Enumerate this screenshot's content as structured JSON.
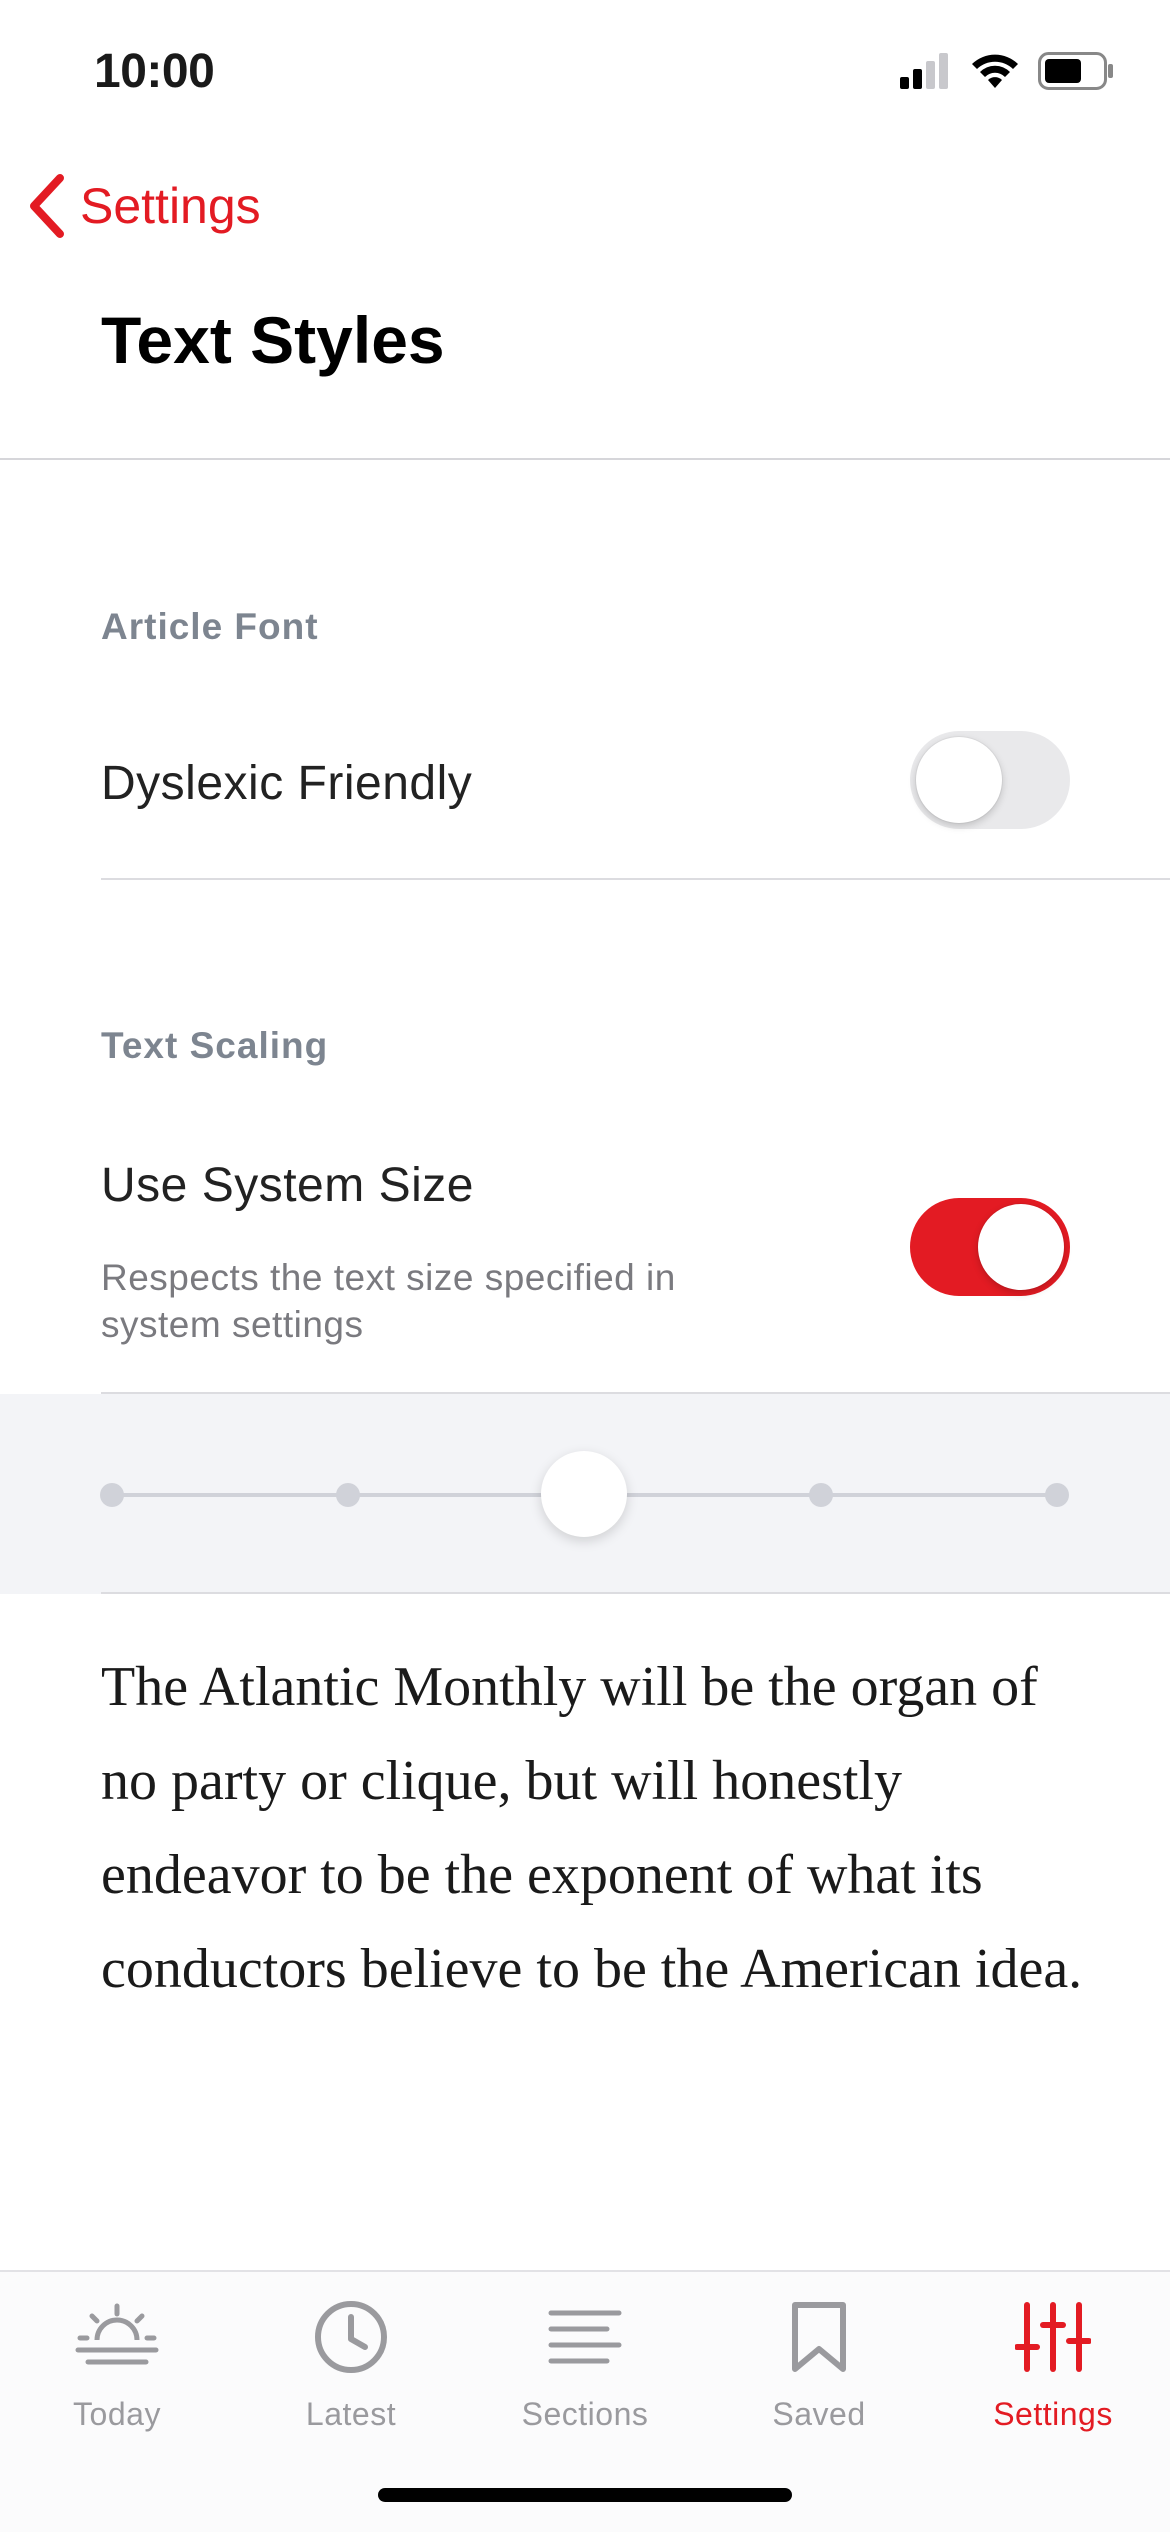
{
  "status_bar": {
    "time": "10:00"
  },
  "nav": {
    "back_label": "Settings",
    "title": "Text Styles"
  },
  "article_font": {
    "header": "Article Font",
    "dyslexic_label": "Dyslexic Friendly",
    "dyslexic_enabled": false
  },
  "text_scaling": {
    "header": "Text Scaling",
    "system_size_label": "Use System Size",
    "system_size_description": "Respects the text size specified in system settings",
    "system_size_enabled": true,
    "slider_steps": 5,
    "slider_selected_index": 2
  },
  "sample_text": "The Atlantic Monthly will be the organ of no party or clique, but will honestly endeavor to be the exponent of what its conductors believe to be the American idea.",
  "tab_bar": {
    "items": [
      {
        "label": "Today",
        "icon": "sunrise-icon",
        "active": false
      },
      {
        "label": "Latest",
        "icon": "clock-icon",
        "active": false
      },
      {
        "label": "Sections",
        "icon": "lines-icon",
        "active": false
      },
      {
        "label": "Saved",
        "icon": "bookmark-icon",
        "active": false
      },
      {
        "label": "Settings",
        "icon": "sliders-icon",
        "active": true
      }
    ]
  },
  "colors": {
    "accent": "#e31b23",
    "inactive": "#9a9a9e",
    "section_header": "#7d8590"
  }
}
